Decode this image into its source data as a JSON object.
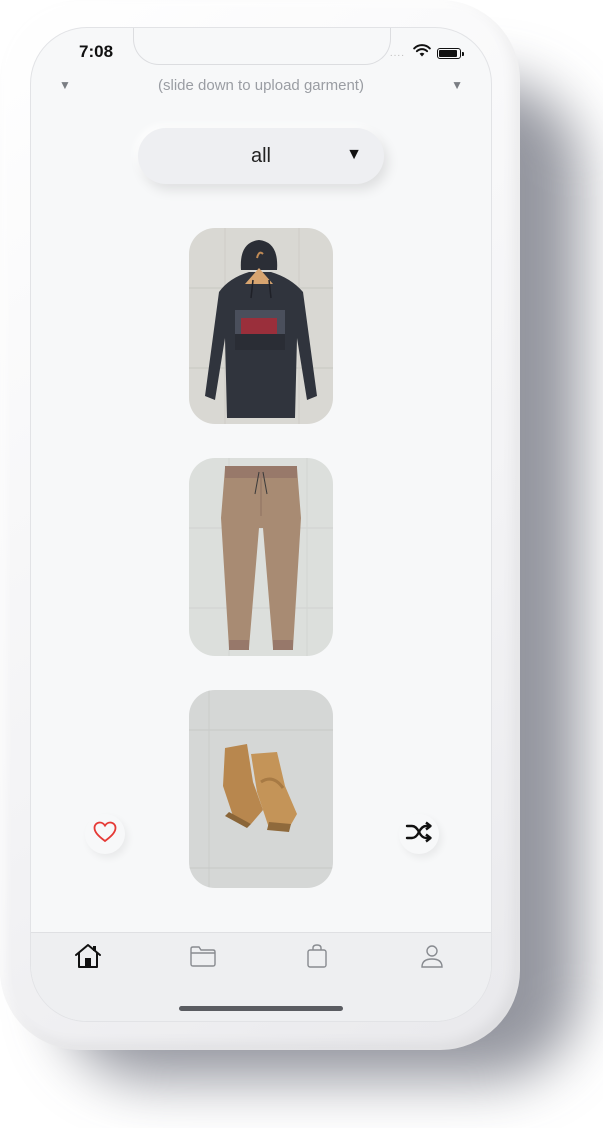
{
  "status_bar": {
    "time": "7:08",
    "signal_dots": "....",
    "icons": [
      "wifi-icon",
      "battery-icon"
    ]
  },
  "upload_hint": {
    "left_arrow": "▼",
    "text": "(slide down to upload garment)",
    "right_arrow": "▼"
  },
  "category_dropdown": {
    "selected": "all",
    "caret": "▼"
  },
  "garments": [
    {
      "slot": "top",
      "item": "dark hoodie with graphic print"
    },
    {
      "slot": "bottom",
      "item": "tan jogger pants"
    },
    {
      "slot": "shoes",
      "item": "tan high-top sneakers"
    }
  ],
  "actions": {
    "like_icon": "heart-icon",
    "shuffle_icon": "shuffle-icon",
    "like_color": "#e53935"
  },
  "tabbar": {
    "tabs": [
      {
        "icon": "home-icon",
        "active": true
      },
      {
        "icon": "folder-icon",
        "active": false
      },
      {
        "icon": "shopping-bag-icon",
        "active": false
      },
      {
        "icon": "profile-icon",
        "active": false
      }
    ]
  }
}
